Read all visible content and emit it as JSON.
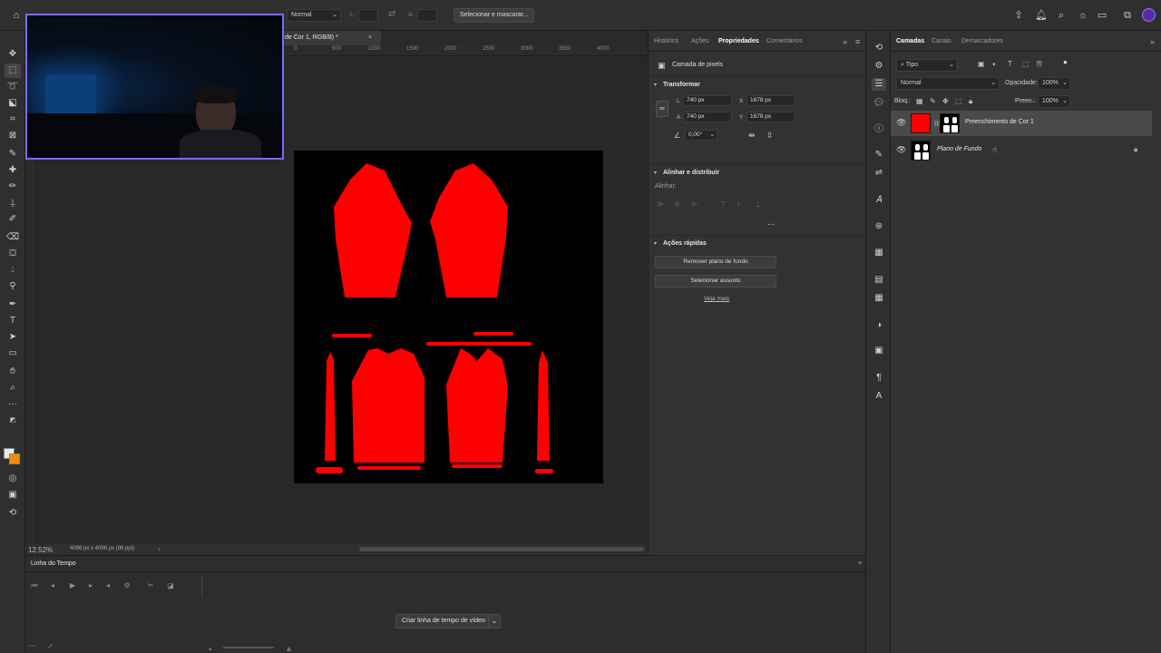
{
  "app": {
    "accent_red": "#ff0000",
    "canvas_bg": "#000000"
  },
  "top_bar": {
    "blend_mode": "Normal",
    "width_label": "L:",
    "height_label": "A:",
    "select_mask_button": "Selecionar e mascarar...",
    "icons": [
      "home-icon",
      "share-icon",
      "bell-icon",
      "search-icon",
      "lightbulb-icon",
      "workspace-icon",
      "window-icon",
      "avatar"
    ]
  },
  "document": {
    "tab_title": "de Cor 1, RGB/8) *",
    "close_glyph": "×",
    "ruler_ticks": [
      "0",
      "500",
      "1000",
      "1500",
      "2000",
      "2500",
      "3000",
      "3500",
      "4000"
    ],
    "zoom": "12.52%",
    "doc_info": "4096 px x 4096 px (96 ppi)"
  },
  "timeline": {
    "tab": "Linha do Tempo",
    "create_button": "Criar linha de tempo de vídeo",
    "controls": [
      "first-frame-icon",
      "prev-frame-icon",
      "play-icon",
      "next-frame-icon",
      "audio-icon",
      "settings-icon",
      "cut-icon",
      "transition-icon"
    ]
  },
  "properties": {
    "tabs": [
      "Histórico",
      "Ações",
      "Propriedades",
      "Comentários"
    ],
    "active_tab": "Propriedades",
    "layer_type": "Camada de pixels",
    "transform": {
      "title": "Transformar",
      "w_label": "L",
      "w": "740 px",
      "h_label": "A",
      "h": "740 px",
      "x_label": "X",
      "x": "1678 px",
      "y_label": "Y",
      "y": "1678 px",
      "angle": "0,00°"
    },
    "align": {
      "title": "Alinhar e distribuir",
      "subtitle": "Alinhar:",
      "more": "..."
    },
    "quick_actions": {
      "title": "Ações rápidas",
      "remove_bg": "Remover plano de fundo",
      "select_subject": "Selecionar assunto",
      "learn_more": "Veja mais"
    }
  },
  "layers": {
    "tabs": [
      "Camadas",
      "Canais",
      "Demarcadores"
    ],
    "active_tab": "Camadas",
    "filter": "Tipo",
    "blend": "Normal",
    "opacity_label": "Opacidade:",
    "opacity": "100%",
    "lock_label": "Bloq.:",
    "fill_label": "Preen.:",
    "fill": "100%",
    "items": [
      {
        "name": "Preenchimento de Cor 1",
        "selected": true,
        "color": "#ff0000"
      },
      {
        "name": "Plano de Fundo",
        "selected": false,
        "locked": true
      }
    ]
  }
}
